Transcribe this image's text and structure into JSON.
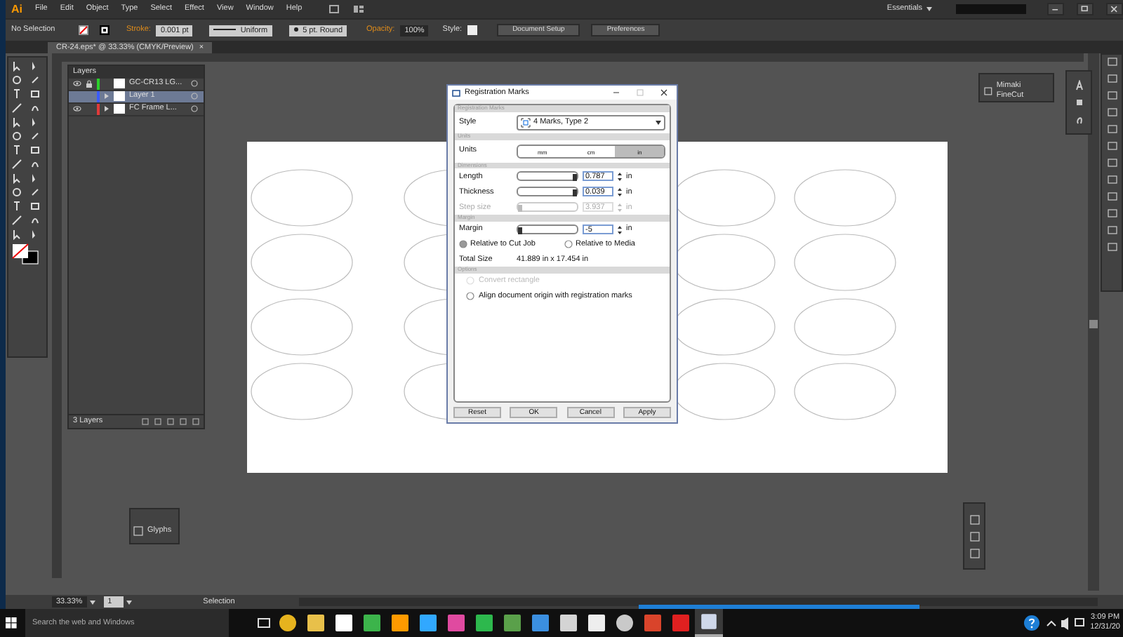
{
  "app": {
    "logo": "Ai",
    "menus": [
      "File",
      "Edit",
      "Object",
      "Type",
      "Select",
      "Effect",
      "View",
      "Window",
      "Help"
    ],
    "workspace": "Essentials"
  },
  "control_bar": {
    "selection": "No Selection",
    "stroke_label": "Stroke:",
    "stroke_weight": "0.001 pt",
    "profile": "Uniform",
    "brush": "5 pt. Round",
    "opacity_label": "Opacity:",
    "opacity": "100%",
    "style_label": "Style:",
    "buttons": [
      "Document Setup",
      "Preferences"
    ]
  },
  "document_tab": {
    "title": "CR-24.eps* @ 33.33% (CMYK/Preview)",
    "close": "×"
  },
  "layers_panel": {
    "title": "Layers",
    "layers": [
      {
        "name": "GC-CR13 LG...",
        "color": "#2bd02b",
        "visible": true,
        "locked": true,
        "expandable": false,
        "selected": false
      },
      {
        "name": "Layer 1",
        "color": "#3b5cff",
        "visible": false,
        "locked": false,
        "expandable": true,
        "selected": true
      },
      {
        "name": "FC Frame L...",
        "color": "#e03a3a",
        "visible": true,
        "locked": false,
        "expandable": true,
        "selected": false
      }
    ],
    "count": "3 Layers"
  },
  "finecut_panel": {
    "title": "Mimaki FineCut"
  },
  "glyphs_panel": {
    "title": "Glyphs"
  },
  "dialog": {
    "title": "Registration Marks",
    "style_section": {
      "heading": "Registration Marks",
      "label": "Style",
      "value": "4 Marks, Type 2"
    },
    "units_section": {
      "heading": "Units",
      "label": "Units",
      "options": [
        {
          "label": "mm",
          "selected": false
        },
        {
          "label": "cm",
          "selected": false
        },
        {
          "label": "in",
          "selected": true
        }
      ]
    },
    "dimensions_section": {
      "heading": "Dimensions",
      "rows": [
        {
          "label": "Length",
          "value": "0.787",
          "unit": "in",
          "level": 1,
          "disabled": false
        },
        {
          "label": "Thickness",
          "value": "0.039",
          "unit": "in",
          "level": 1,
          "disabled": false
        },
        {
          "label": "Step size",
          "value": "3.937",
          "unit": "in",
          "level": 0,
          "disabled": true
        }
      ]
    },
    "margin_section": {
      "heading": "Margin",
      "label": "Margin",
      "value": "-5",
      "unit": "in",
      "level": 0,
      "relative": [
        {
          "label": "Relative to Cut Job",
          "selected": true
        },
        {
          "label": "Relative to Media",
          "selected": false
        }
      ],
      "total_label": "Total Size",
      "total_value": "41.889 in x 17.454 in"
    },
    "options_section": {
      "heading": "Options",
      "checks": [
        {
          "label": "Convert rectangle",
          "checked": false,
          "disabled": true
        },
        {
          "label": "Align document origin with registration marks",
          "checked": false,
          "disabled": false
        }
      ]
    },
    "buttons": [
      "Reset",
      "OK",
      "Cancel",
      "Apply"
    ]
  },
  "status_bar": {
    "zoom": "33.33%",
    "artboard": "1",
    "tool": "Selection"
  },
  "taskbar": {
    "search_placeholder": "Search the web and Windows",
    "time": "3:09 PM",
    "date": "12/31/20"
  }
}
